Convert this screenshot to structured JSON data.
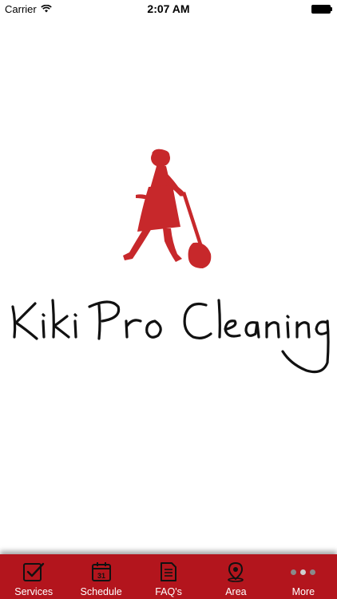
{
  "status_bar": {
    "carrier": "Carrier",
    "time": "2:07 AM"
  },
  "logo": {
    "text": "Kiki Pro Cleaning",
    "brand_color": "#c7282b"
  },
  "tab_bar": {
    "background": "#b3151d",
    "tabs": [
      {
        "label": "Services",
        "icon": "checkbox-icon"
      },
      {
        "label": "Schedule",
        "icon": "calendar-icon",
        "calendar_day": "31"
      },
      {
        "label": "FAQ's",
        "icon": "document-icon"
      },
      {
        "label": "Area",
        "icon": "map-pin-icon"
      },
      {
        "label": "More",
        "icon": "more-dots-icon"
      }
    ]
  }
}
